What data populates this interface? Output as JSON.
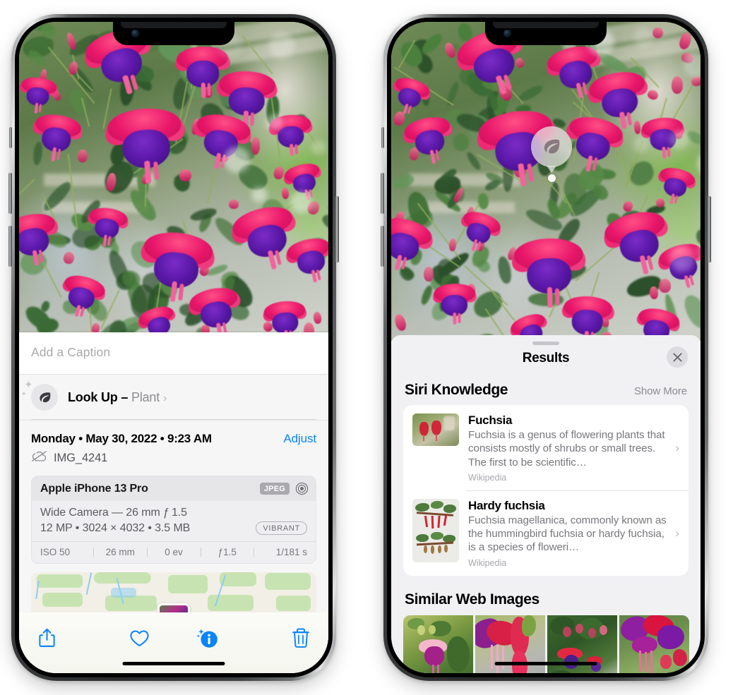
{
  "colors": {
    "accent_blue": "#0a84ff",
    "sheet_bg": "#f1f1f4",
    "card_white": "#ffffff",
    "secondary_text": "#77777d",
    "badge_gray": "#a9a9ae"
  },
  "left_phone": {
    "name": "photos-detail-screen",
    "caption": {
      "placeholder": "Add a Caption",
      "value": ""
    },
    "lookup": {
      "icon": "leaf-icon",
      "label": "Look Up – ",
      "subject": "Plant",
      "chevron": "›"
    },
    "meta": {
      "date": "Monday • May 30, 2022 • 9:23 AM",
      "adjust_label": "Adjust",
      "cloud_icon": "cloud-slash-icon",
      "filename": "IMG_4241"
    },
    "exif": {
      "device": "Apple iPhone 13 Pro",
      "format_badge": "JPEG",
      "lens_icon": "lens-icon",
      "lens_line": "Wide Camera — 26 mm ƒ 1.5",
      "size_line": "12 MP • 3024 × 4032 • 3.5 MB",
      "quality_badge": "VIBRANT",
      "stats": [
        "ISO 50",
        "26 mm",
        "0 ev",
        "ƒ1.5",
        "1/181 s"
      ]
    },
    "map": {
      "name": "location-map-thumbnail"
    },
    "toolbar": [
      {
        "name": "share-button",
        "icon": "share-icon"
      },
      {
        "name": "favorite-button",
        "icon": "heart-icon"
      },
      {
        "name": "info-button",
        "icon": "info-sparkle-icon"
      },
      {
        "name": "delete-button",
        "icon": "trash-icon"
      }
    ]
  },
  "right_phone": {
    "name": "visual-lookup-results-screen",
    "leaf_marker": {
      "icon": "leaf-icon"
    },
    "sheet": {
      "grabber": "sheet-grabber",
      "title": "Results",
      "close_icon": "close-icon"
    },
    "siri_knowledge": {
      "title": "Siri Knowledge",
      "show_more": "Show More",
      "items": [
        {
          "title": "Fuchsia",
          "description": "Fuchsia is a genus of flowering plants that consists mostly of shrubs or small trees. The first to be scientific…",
          "source": "Wikipedia",
          "thumb": "fuchsia-red-flowers-thumbnail"
        },
        {
          "title": "Hardy fuchsia",
          "description": "Fuchsia magellanica, commonly known as the hummingbird fuchsia or hardy fuchsia, is a species of floweri…",
          "source": "Wikipedia",
          "thumb": "hardy-fuchsia-specimen-thumbnail"
        }
      ]
    },
    "similar_web_images": {
      "title": "Similar Web Images",
      "items": [
        {
          "name": "web-image-1",
          "alt": "pink and magenta fuchsia with green leaves"
        },
        {
          "name": "web-image-2",
          "alt": "close-up red and pink fuchsia bloom"
        },
        {
          "name": "web-image-3",
          "alt": "fuchsia shrub with red buds"
        },
        {
          "name": "web-image-4",
          "alt": "purple and red double fuchsia flowers"
        }
      ]
    }
  }
}
